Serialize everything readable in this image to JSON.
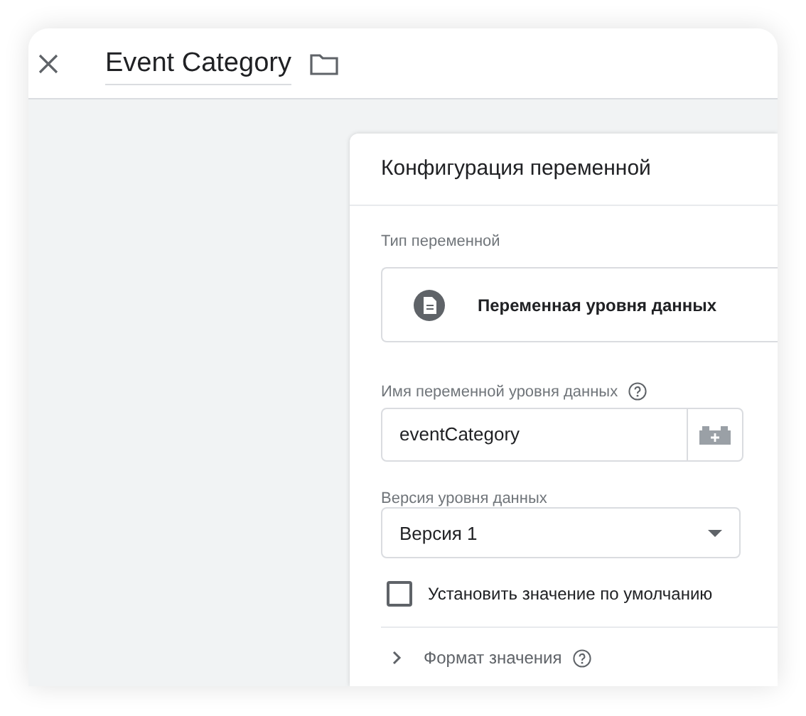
{
  "header": {
    "title": "Event Category"
  },
  "card": {
    "title": "Конфигурация переменной",
    "variable_type": {
      "label": "Тип переменной",
      "value": "Переменная уровня данных"
    },
    "name_field": {
      "label": "Имя переменной уровня данных",
      "value": "eventCategory"
    },
    "version_field": {
      "label": "Версия уровня данных",
      "value": "Версия 1"
    },
    "default_checkbox": {
      "label": "Установить значение по умолчанию",
      "checked": false
    },
    "value_format": {
      "label": "Формат значения",
      "expanded": false
    }
  }
}
